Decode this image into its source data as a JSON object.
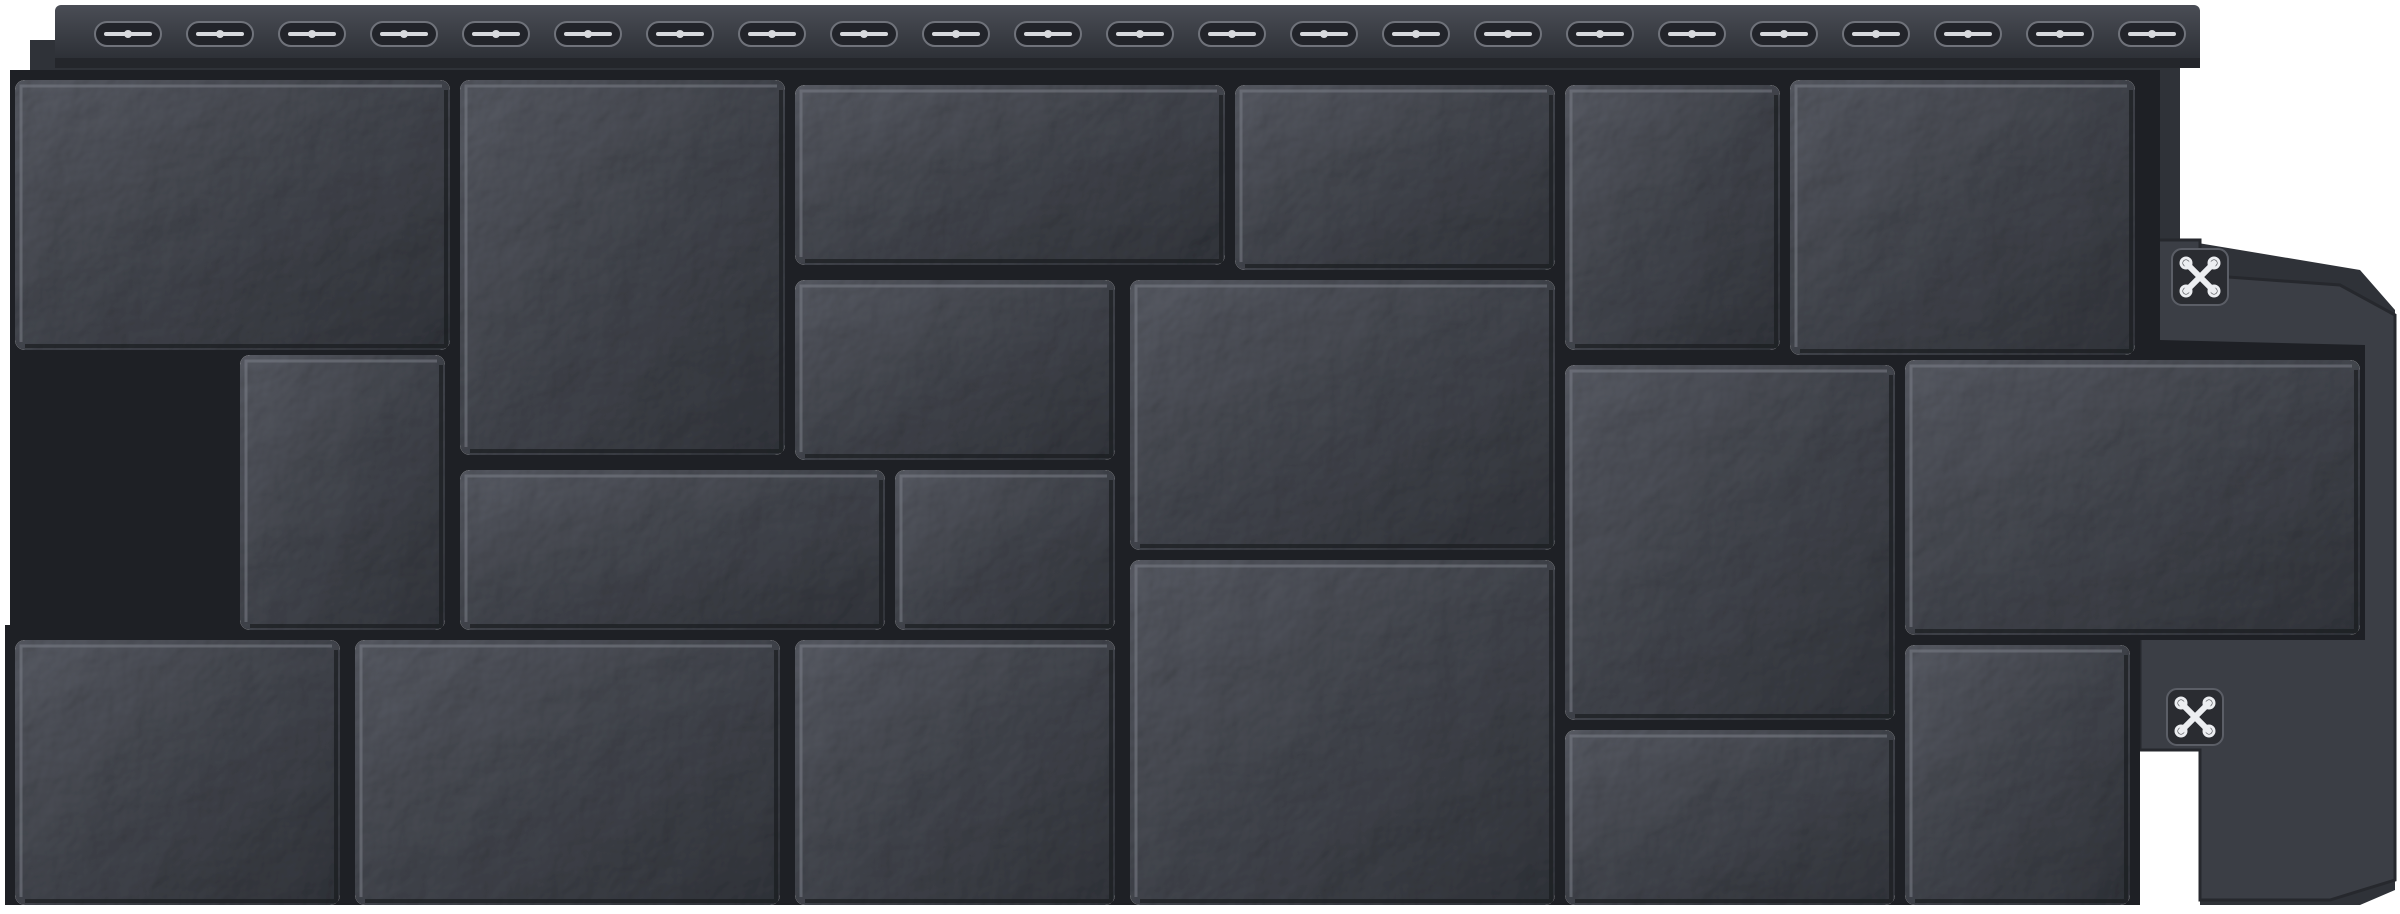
{
  "product": {
    "subject": "facade-stone-panel",
    "color_name": "graphite",
    "colors": {
      "background": "#ffffff",
      "panel_base": "#3a3d44",
      "stone_light": "#5a5d66",
      "stone_mid": "#484b53",
      "stone_dark": "#33363d",
      "grout": "#1f2126",
      "mount_strip": "#2c2f35",
      "slot_fill": "#d7d9dd"
    },
    "icons": [
      "nail-slot-icon",
      "cross-joint-marker-icon"
    ]
  }
}
